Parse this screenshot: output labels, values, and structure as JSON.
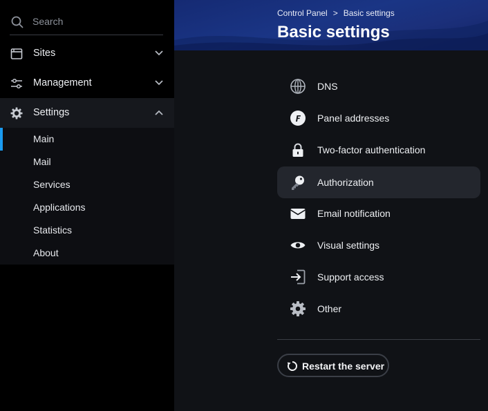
{
  "sidebar": {
    "search": {
      "placeholder": "Search"
    },
    "items": [
      {
        "label": "Sites",
        "icon": "browser-window-icon",
        "expanded": false
      },
      {
        "label": "Management",
        "icon": "sliders-icon",
        "expanded": false
      },
      {
        "label": "Settings",
        "icon": "gear-icon",
        "expanded": true
      }
    ],
    "settings_submenu": [
      {
        "label": "Main",
        "active": true
      },
      {
        "label": "Mail",
        "active": false
      },
      {
        "label": "Services",
        "active": false
      },
      {
        "label": "Applications",
        "active": false
      },
      {
        "label": "Statistics",
        "active": false
      },
      {
        "label": "About",
        "active": false
      }
    ]
  },
  "header": {
    "breadcrumbs": [
      "Control Panel",
      "Basic settings"
    ],
    "breadcrumb_separator": ">",
    "title": "Basic settings"
  },
  "main": {
    "items": [
      {
        "label": "DNS",
        "icon": "globe-icon",
        "selected": false
      },
      {
        "label": "Panel addresses",
        "icon": "panel-logo-icon",
        "selected": false
      },
      {
        "label": "Two-factor authentication",
        "icon": "lock-icon",
        "selected": false
      },
      {
        "label": "Authorization",
        "icon": "key-icon",
        "selected": true
      },
      {
        "label": "Email notification",
        "icon": "envelope-icon",
        "selected": false
      },
      {
        "label": "Visual settings",
        "icon": "eye-icon",
        "selected": false
      },
      {
        "label": "Support access",
        "icon": "sign-in-icon",
        "selected": false
      },
      {
        "label": "Other",
        "icon": "gear-icon",
        "selected": false
      }
    ],
    "restart_button": {
      "label": "Restart the server",
      "icon": "restart-icon"
    }
  },
  "colors": {
    "accent": "#1a9bf0",
    "header_bg": "#1a3585",
    "sidebar_bg": "#000000",
    "main_bg": "#101216",
    "selected_bg": "#23262d"
  }
}
